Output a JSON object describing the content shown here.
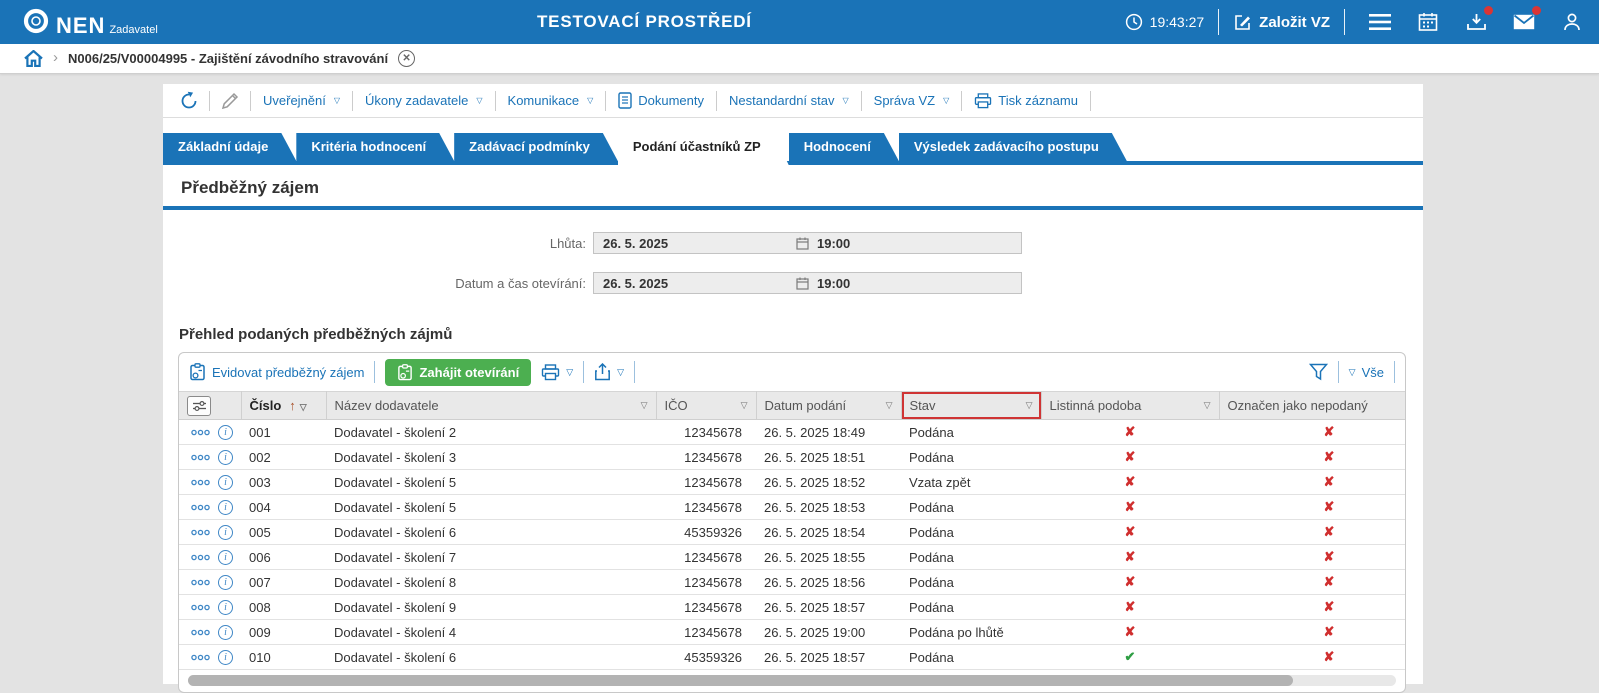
{
  "topbar": {
    "brand": "NEN",
    "brand_sub": "Zadavatel",
    "title": "TESTOVACÍ PROSTŘEDÍ",
    "time": "19:43:27",
    "create_vz_label": "Založit VZ"
  },
  "breadcrumb": {
    "label": "N006/25/V00004995 - Zajištění závodního stravování"
  },
  "actionbar": {
    "items": [
      {
        "label": "Uveřejnění",
        "dropdown": true
      },
      {
        "label": "Úkony zadavatele",
        "dropdown": true
      },
      {
        "label": "Komunikace",
        "dropdown": true
      },
      {
        "label": "Dokumenty",
        "icon": "document",
        "dropdown": false
      },
      {
        "label": "Nestandardní stav",
        "dropdown": true
      },
      {
        "label": "Správa VZ",
        "dropdown": true
      },
      {
        "label": "Tisk záznamu",
        "icon": "printer",
        "dropdown": false
      }
    ]
  },
  "tabs": {
    "active_index": 3,
    "items": [
      {
        "label": "Základní údaje"
      },
      {
        "label": "Kritéria hodnocení"
      },
      {
        "label": "Zadávací podmínky"
      },
      {
        "label": "Podání účastníků ZP"
      },
      {
        "label": "Hodnocení"
      },
      {
        "label": "Výsledek zadávacího postupu"
      }
    ]
  },
  "section": {
    "title": "Předběžný zájem"
  },
  "form": {
    "rows": [
      {
        "label": "Lhůta:",
        "date": "26. 5. 2025",
        "time": "19:00"
      },
      {
        "label": "Datum a čas otevírání:",
        "date": "26. 5. 2025",
        "time": "19:00"
      }
    ]
  },
  "list": {
    "heading": "Přehled podaných předběžných zájmů",
    "toolbar": {
      "evidovat_label": "Evidovat předběžný zájem",
      "zahajit_label": "Zahájit otevírání",
      "vse_label": "Vše"
    }
  },
  "table": {
    "columns": [
      {
        "type": "actions"
      },
      {
        "label": "Číslo",
        "sorted": "asc",
        "dropdown": true
      },
      {
        "label": "Název dodavatele",
        "dropdown": true
      },
      {
        "label": "IČO",
        "dropdown": true
      },
      {
        "label": "Datum podání",
        "dropdown": true
      },
      {
        "label": "Stav",
        "dropdown": true,
        "highlighted": true
      },
      {
        "label": "Listinná podoba",
        "dropdown": true
      },
      {
        "label": "Označen jako nepodaný",
        "dropdown": false
      }
    ],
    "rows": [
      {
        "cislo": "001",
        "dodavatel": "Dodavatel - školení 2",
        "ico": "12345678",
        "datum": "26. 5. 2025 18:49",
        "stav": "Podána",
        "listinna": false,
        "nepodany": false
      },
      {
        "cislo": "002",
        "dodavatel": "Dodavatel - školení 3",
        "ico": "12345678",
        "datum": "26. 5. 2025 18:51",
        "stav": "Podána",
        "listinna": false,
        "nepodany": false
      },
      {
        "cislo": "003",
        "dodavatel": "Dodavatel - školení 5",
        "ico": "12345678",
        "datum": "26. 5. 2025 18:52",
        "stav": "Vzata zpět",
        "listinna": false,
        "nepodany": false
      },
      {
        "cislo": "004",
        "dodavatel": "Dodavatel - školení 5",
        "ico": "12345678",
        "datum": "26. 5. 2025 18:53",
        "stav": "Podána",
        "listinna": false,
        "nepodany": false
      },
      {
        "cislo": "005",
        "dodavatel": "Dodavatel - školení 6",
        "ico": "45359326",
        "datum": "26. 5. 2025 18:54",
        "stav": "Podána",
        "listinna": false,
        "nepodany": false
      },
      {
        "cislo": "006",
        "dodavatel": "Dodavatel - školení 7",
        "ico": "12345678",
        "datum": "26. 5. 2025 18:55",
        "stav": "Podána",
        "listinna": false,
        "nepodany": false
      },
      {
        "cislo": "007",
        "dodavatel": "Dodavatel - školení 8",
        "ico": "12345678",
        "datum": "26. 5. 2025 18:56",
        "stav": "Podána",
        "listinna": false,
        "nepodany": false
      },
      {
        "cislo": "008",
        "dodavatel": "Dodavatel - školení 9",
        "ico": "12345678",
        "datum": "26. 5. 2025 18:57",
        "stav": "Podána",
        "listinna": false,
        "nepodany": false
      },
      {
        "cislo": "009",
        "dodavatel": "Dodavatel - školení 4",
        "ico": "12345678",
        "datum": "26. 5. 2025 19:00",
        "stav": "Podána po lhůtě",
        "listinna": false,
        "nepodany": false
      },
      {
        "cislo": "010",
        "dodavatel": "Dodavatel - školení 6",
        "ico": "45359326",
        "datum": "26. 5. 2025 18:57",
        "stav": "Podána",
        "listinna": true,
        "nepodany": false
      }
    ]
  },
  "colors": {
    "primary_blue": "#1a73b7",
    "green": "#4caf50",
    "cross_red": "#d02f2f",
    "check_green": "#2f9e44",
    "highlight_red": "#cf3434"
  }
}
